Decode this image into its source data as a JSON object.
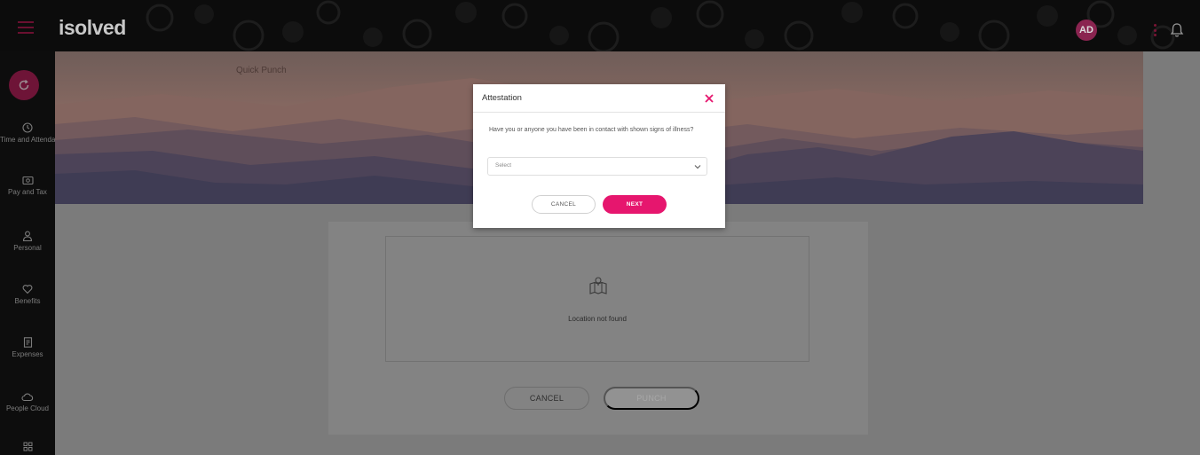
{
  "topbar": {
    "logo": "isolved",
    "avatar_initials": "AD",
    "accent_color": "#e6166e"
  },
  "sidebar": {
    "items": [
      {
        "label": "Time and Attendance",
        "icon": "clock-icon"
      },
      {
        "label": "Pay and Tax",
        "icon": "money-icon"
      },
      {
        "label": "Personal",
        "icon": "person-icon"
      },
      {
        "label": "Benefits",
        "icon": "heart-icon"
      },
      {
        "label": "Expenses",
        "icon": "receipt-icon"
      },
      {
        "label": "People Cloud",
        "icon": "cloud-icon"
      },
      {
        "label": "",
        "icon": "apps-grid-icon"
      }
    ]
  },
  "page": {
    "title": "Quick Punch",
    "location_status": "Location not found",
    "cancel_label": "CANCEL",
    "punch_label": "PUNCH"
  },
  "modal": {
    "title": "Attestation",
    "question": "Have you or anyone you have been in contact with shown signs of illness?",
    "select_value": "Select",
    "cancel_label": "CANCEL",
    "next_label": "NEXT"
  }
}
